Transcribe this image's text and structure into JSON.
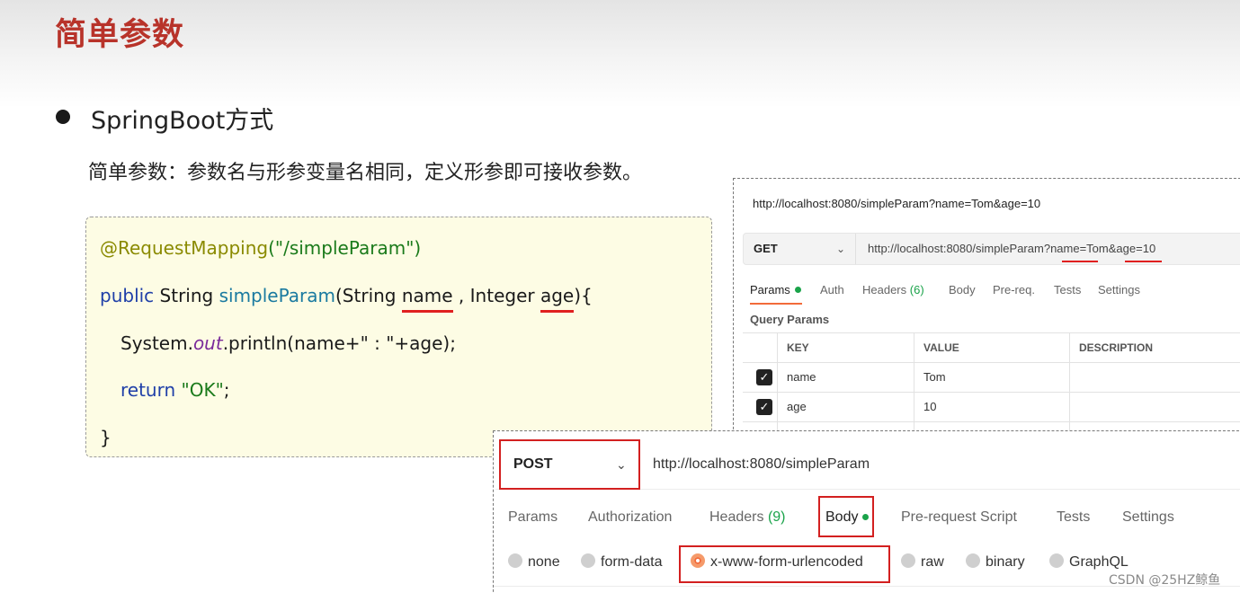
{
  "slide": {
    "title": "简单参数",
    "bullet": "SpringBoot方式",
    "description": "简单参数：参数名与形参变量名相同，定义形参即可接收参数。"
  },
  "code": {
    "line1_annotation": "@RequestMapping",
    "line1_args": "(\"/simpleParam\")",
    "line2_public": "public",
    "line2_type": " String ",
    "line2_method": "simpleParam",
    "line2_open": "(String ",
    "line2_param1": "name",
    "line2_mid": " , Integer ",
    "line2_param2": "age",
    "line2_close": "){",
    "line3_prefix": "System.",
    "line3_out": "out",
    "line3_rest": ".println(name+\" : \"+age);",
    "line4_return": "return",
    "line4_value": " \"OK\"",
    "line4_end": ";",
    "line5": "}"
  },
  "get_panel": {
    "title_url": "http://localhost:8080/simpleParam?name=Tom&age=10",
    "method": "GET",
    "url_base": "http://localhost:8080/simpleParam?",
    "url_name": "name",
    "url_mid": "=Tom&",
    "url_age": "age",
    "url_end": "=10",
    "tabs": {
      "params": "Params",
      "auth": "Auth",
      "headers": "Headers",
      "headers_count": "(6)",
      "body": "Body",
      "prereq": "Pre-req.",
      "tests": "Tests",
      "settings": "Settings"
    },
    "query_params_label": "Query Params",
    "columns": [
      "KEY",
      "VALUE",
      "DESCRIPTION"
    ],
    "rows": [
      {
        "key": "name",
        "value": "Tom",
        "checked": true
      },
      {
        "key": "age",
        "value": "10",
        "checked": true
      }
    ]
  },
  "post_panel": {
    "method": "POST",
    "url": "http://localhost:8080/simpleParam",
    "tabs": {
      "params": "Params",
      "authorization": "Authorization",
      "headers": "Headers",
      "headers_count": "(9)",
      "body": "Body",
      "prerequest": "Pre-request Script",
      "tests": "Tests",
      "settings": "Settings"
    },
    "body_types": [
      "none",
      "form-data",
      "x-www-form-urlencoded",
      "raw",
      "binary",
      "GraphQL"
    ],
    "selected_body_type": "x-www-form-urlencoded"
  },
  "watermark": "CSDN @25HZ鲸鱼",
  "colors": {
    "title_red": "#b8332a",
    "highlight_red": "#d32020",
    "active_orange": "#f26b3a",
    "dot_green": "#1aa34a",
    "code_bg": "#fdfce4"
  }
}
